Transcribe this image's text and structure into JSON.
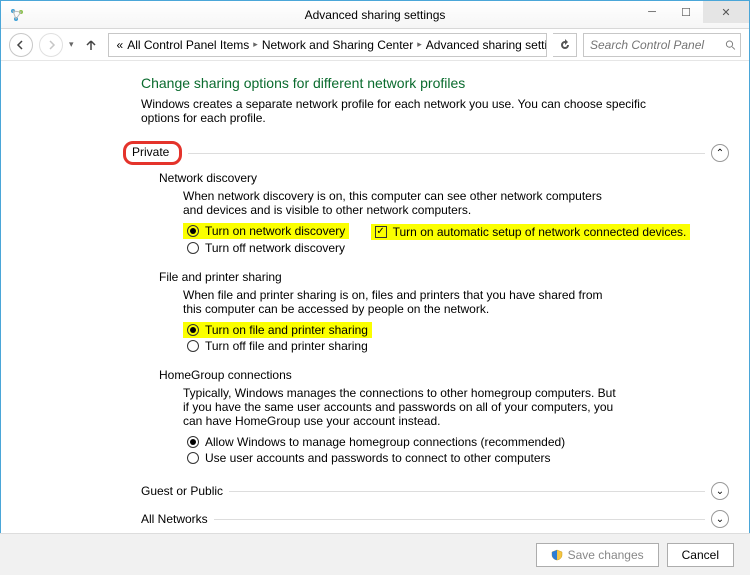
{
  "window": {
    "title": "Advanced sharing settings"
  },
  "nav": {
    "breadcrumb_prefix": "«",
    "crumb1": "All Control Panel Items",
    "crumb2": "Network and Sharing Center",
    "crumb3": "Advanced sharing settings",
    "search_placeholder": "Search Control Panel"
  },
  "page": {
    "title": "Change sharing options for different network profiles",
    "subtitle": "Windows creates a separate network profile for each network you use. You can choose specific options for each profile."
  },
  "profiles": {
    "private": {
      "label": "Private",
      "network_discovery": {
        "title": "Network discovery",
        "desc": "When network discovery is on, this computer can see other network computers and devices and is visible to other network computers.",
        "opt_on": "Turn on network discovery",
        "opt_auto": "Turn on automatic setup of network connected devices.",
        "opt_off": "Turn off network discovery"
      },
      "file_printer": {
        "title": "File and printer sharing",
        "desc": "When file and printer sharing is on, files and printers that you have shared from this computer can be accessed by people on the network.",
        "opt_on": "Turn on file and printer sharing",
        "opt_off": "Turn off file and printer sharing"
      },
      "homegroup": {
        "title": "HomeGroup connections",
        "desc": "Typically, Windows manages the connections to other homegroup computers. But if you have the same user accounts and passwords on all of your computers, you can have HomeGroup use your account instead.",
        "opt_allow": "Allow Windows to manage homegroup connections (recommended)",
        "opt_user": "Use user accounts and passwords to connect to other computers"
      }
    },
    "guest": {
      "label": "Guest or Public"
    },
    "all": {
      "label": "All Networks"
    }
  },
  "footer": {
    "save": "Save changes",
    "cancel": "Cancel"
  }
}
